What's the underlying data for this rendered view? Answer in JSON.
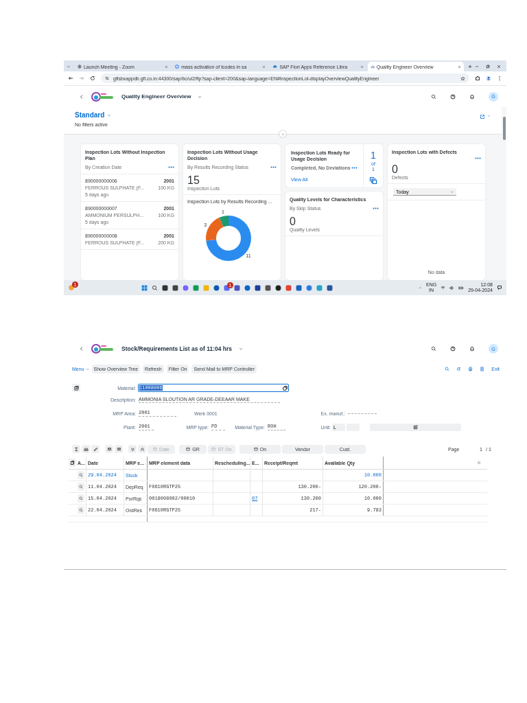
{
  "browser": {
    "tabs": [
      {
        "title": "Launch Meeting - Zoom",
        "selected": false
      },
      {
        "title": "mass activation of tcodes in sa",
        "selected": false
      },
      {
        "title": "SAP Fiori Apps Reference Libra",
        "selected": false
      },
      {
        "title": "Quality Engineer Overview",
        "selected": true
      }
    ],
    "url": "gflsbxappdb.gfl.co.in:44300/sap/bc/ui2/flp?sap-client=200&sap-language=EN#InspectionLot-displayOverviewQualityEngineer"
  },
  "overview": {
    "title": "Quality Engineer Overview",
    "avatar": "G",
    "variant": "Standard",
    "filter_status": "No filters active",
    "columns": [
      {
        "cards": [
          {
            "kind": "list",
            "title": "Inspection Lots Without Inspection Plan",
            "subtitle": "By Creation Date",
            "items": [
              {
                "id": "890000000006",
                "plant": "2001",
                "material": "FERROUS SULPHATE (F...",
                "quantity": "100 KG",
                "age": "5 days ago"
              },
              {
                "id": "890000000007",
                "plant": "2001",
                "material": "AMMONIUM PERSULPH...",
                "quantity": "100 KG",
                "age": "5 days ago"
              },
              {
                "id": "890000000008",
                "plant": "2001",
                "material": "FERROUS SULPHATE (F...",
                "quantity": "200 KG"
              }
            ]
          }
        ]
      },
      {
        "cards": [
          {
            "kind": "donut",
            "title": "Inspection Lots Without Usage Decision",
            "subtitle": "By Results Recording Status",
            "kpi": "15",
            "unit": "Inspection Lots",
            "chart_data": {
              "type": "donut",
              "title": "Inspection Lots by Results Recording ...",
              "values": [
                11,
                3,
                1
              ],
              "data_labels": true
            }
          }
        ]
      },
      {
        "cards": [
          {
            "kind": "stack",
            "title": "Inspection Lots Ready for Usage Decision",
            "subtitle": "Completed, No Deviations",
            "link": "View All",
            "count": "1",
            "of": "of",
            "total": "1"
          },
          {
            "kind": "kpi",
            "title": "Quality Levels for Characteristics",
            "subtitle": "By Skip Status",
            "kpi": "0",
            "unit": "Quality Levels"
          }
        ]
      },
      {
        "cards": [
          {
            "kind": "filter_kpi",
            "title": "Inspection Lots with Defects",
            "kpi": "0",
            "unit": "Defects",
            "filter": "Today",
            "empty_text": "No data"
          }
        ]
      }
    ]
  },
  "taskbar": {
    "weather_badge": "1",
    "chat_badge": "1",
    "language": "ENG",
    "region": "IN",
    "time": "12:08",
    "date": "29-04-2024"
  },
  "stock": {
    "title": "Stock/Requirements List as of 11:04 hrs",
    "avatar": "G",
    "menu": "Menu",
    "actions": [
      "Show Overview Tree",
      "Refresh",
      "Filter On",
      "Send Mail to MRP Controller"
    ],
    "exit": "Exit",
    "material_label": "Material:",
    "material": "11008006",
    "description_label": "Description:",
    "description": "AMMONIA SLOUTION AR GRADE-DEEAAR MAKE",
    "mrp_area_label": "MRP Area:",
    "mrp_area": "2001",
    "werk": "Werk 0001",
    "ex_manuf_label": "Ex. manuf.:",
    "plant_label": "Plant:",
    "plant": "2001",
    "mrp_type_label": "MRP type:",
    "mrp_type": "PD",
    "material_type_label": "Material Type:",
    "material_type": "ROH",
    "unit_label": "Unit:",
    "unit": "L",
    "toolbar_buttons": [
      {
        "label": "Date",
        "disabled": true
      },
      {
        "label": "GR",
        "disabled": false
      },
      {
        "label": "ST On",
        "disabled": true
      },
      {
        "label": "On",
        "disabled": false
      },
      {
        "label": "Vendor",
        "disabled": false
      },
      {
        "label": "Cust.",
        "disabled": false
      }
    ],
    "page_label": "Page",
    "page": "1",
    "page_total": "/ 1",
    "columns": [
      "A...",
      "Date",
      "MRP e...",
      "MRP element data",
      "Rescheduling...",
      "E...",
      "Receipt/Reqmt",
      "Available Qty"
    ],
    "rows": [
      {
        "kind": "stock",
        "date": "29.04.2024",
        "element": "Stock",
        "available": "10.000"
      },
      {
        "kind": "item",
        "date": "11.04.2024",
        "element": "DepReq",
        "data": "F0610RGTP25",
        "receipt": "130.200-",
        "available": "120.200-"
      },
      {
        "kind": "item",
        "date": "15.04.2024",
        "element": "PurRqs",
        "data": "0018008002/00010",
        "exception": "07",
        "receipt": "130.200",
        "available": "10.000"
      },
      {
        "kind": "item",
        "date": "22.04.2024",
        "element": "OrdRes",
        "data": "F0610RGTP25",
        "receipt": "217-",
        "available": "9.783"
      }
    ]
  }
}
